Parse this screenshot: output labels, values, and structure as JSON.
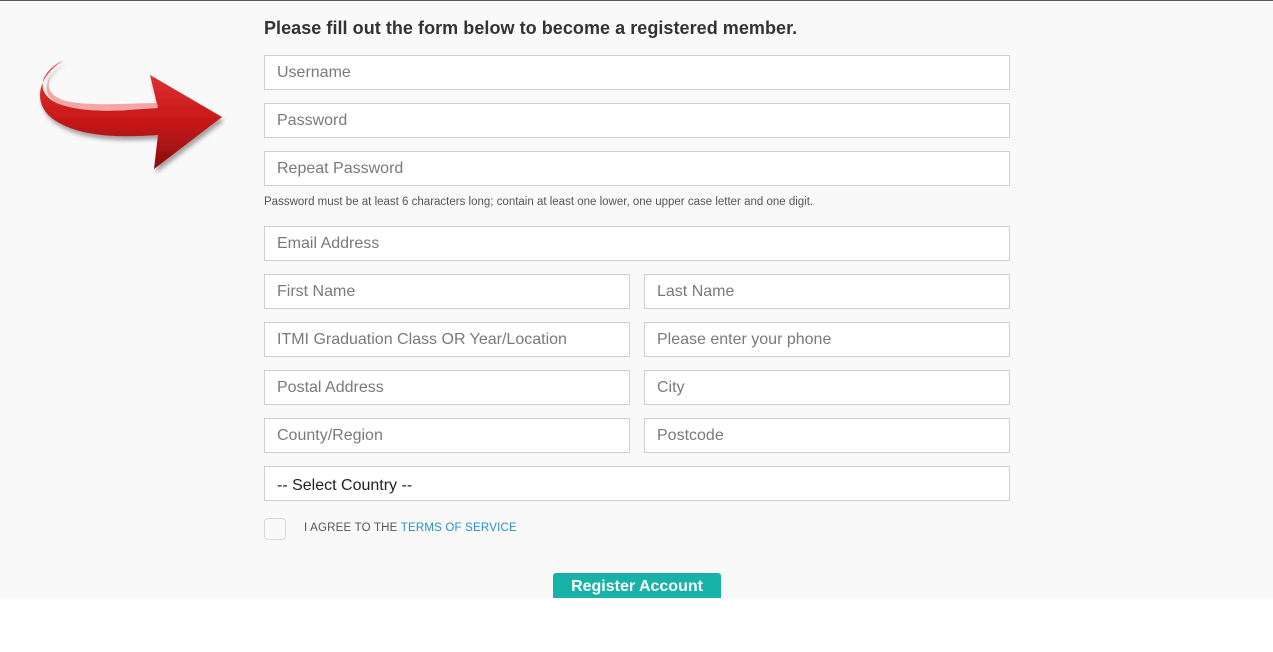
{
  "form": {
    "heading": "Please fill out the form below to become a registered member.",
    "username_placeholder": "Username",
    "password_placeholder": "Password",
    "repeat_password_placeholder": "Repeat Password",
    "password_hint": "Password must be at least 6 characters long; contain at least one lower, one upper case letter and one digit.",
    "email_placeholder": "Email Address",
    "first_name_placeholder": "First Name",
    "last_name_placeholder": "Last Name",
    "graduation_placeholder": "ITMI Graduation Class OR Year/Location",
    "phone_placeholder": "Please enter your phone",
    "postal_address_placeholder": "Postal Address",
    "city_placeholder": "City",
    "county_placeholder": "County/Region",
    "postcode_placeholder": "Postcode",
    "country_selected": "-- Select Country --",
    "agree_text": "I AGREE TO THE",
    "terms_link": "TERMS OF SERVICE",
    "register_label": "Register Account"
  },
  "decor": {
    "arrow_icon": "curved-red-arrow-icon",
    "arrow_color": "#d42020",
    "accent_color": "#17b3a9"
  }
}
